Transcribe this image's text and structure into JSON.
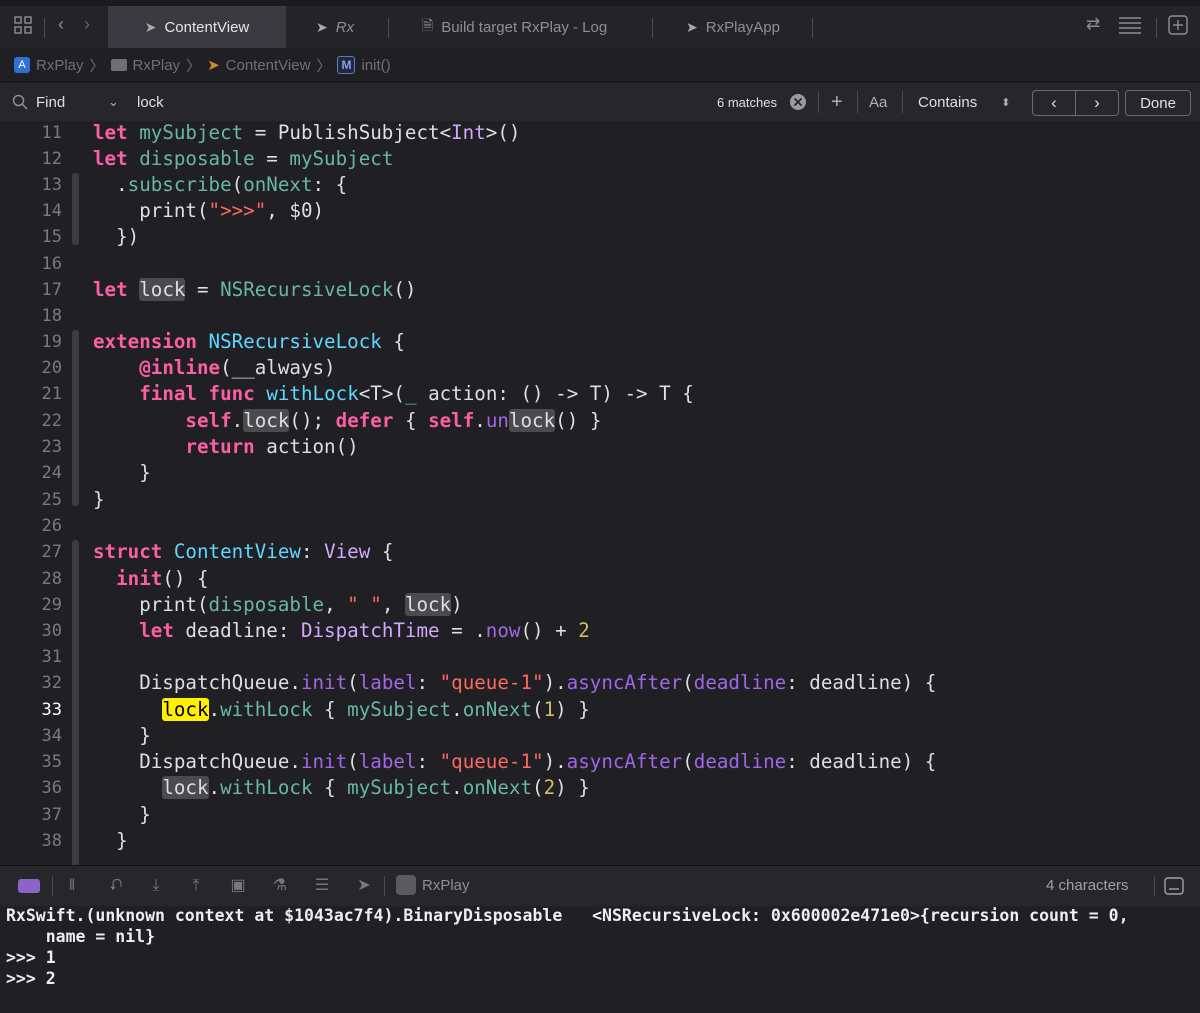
{
  "tabs": [
    {
      "label": "ContentView",
      "icon": "swift-icon",
      "active": true
    },
    {
      "label": "Rx",
      "icon": "swift-icon",
      "active": false
    },
    {
      "label": "Build target RxPlay - Log",
      "icon": "document-icon",
      "active": false
    },
    {
      "label": "RxPlayApp",
      "icon": "swift-icon",
      "active": false
    }
  ],
  "breadcrumb": {
    "items": [
      "RxPlay",
      "RxPlay",
      "ContentView",
      "init()"
    ],
    "method_badge": "M"
  },
  "find": {
    "mode_label": "Find",
    "query": "lock",
    "matches": "6 matches",
    "case_label": "Aa",
    "match_type": "Contains",
    "done_label": "Done"
  },
  "editor": {
    "current_line": "33",
    "line_numbers": [
      "11",
      "12",
      "13",
      "14",
      "15",
      "16",
      "17",
      "18",
      "19",
      "20",
      "21",
      "22",
      "23",
      "24",
      "25",
      "26",
      "27",
      "28",
      "29",
      "30",
      "31",
      "32",
      "33",
      "34",
      "35",
      "36",
      "37",
      "38"
    ]
  },
  "debug": {
    "target": "RxPlay",
    "status": "4 characters"
  },
  "console": {
    "lines": [
      "RxSwift.(unknown context at $1043ac7f4).BinaryDisposable   <NSRecursiveLock: 0x600002e471e0>{recursion count = 0,",
      "    name = nil}",
      ">>> 1",
      ">>> 2"
    ]
  },
  "colors": {
    "keyword": "#fc5fa3",
    "type": "#5dd8ff",
    "string": "#fc6a5d",
    "number": "#d0bf69",
    "current_match": "#ffef00",
    "background": "#1f1f24"
  }
}
